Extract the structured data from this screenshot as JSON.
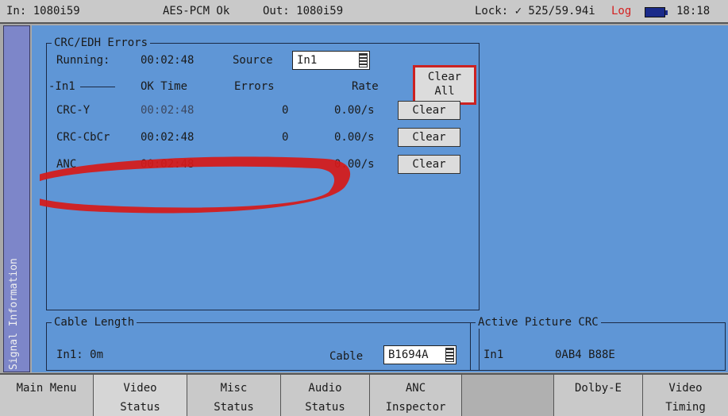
{
  "status": {
    "input": "In: 1080i59",
    "audio": "AES-PCM Ok",
    "output": "Out: 1080i59",
    "lock": "Lock: ✓ 525/59.94i",
    "log": "Log",
    "time": "18:18"
  },
  "sidebar": {
    "label": "Signal Information"
  },
  "crc_edh": {
    "title": "CRC/EDH Errors",
    "running_label": "Running:",
    "running_value": "00:02:48",
    "source_label": "Source",
    "source_value": "In1",
    "clear_all_line1": "Clear",
    "clear_all_line2": "All",
    "table_input": "-In1",
    "col_ok_time": "OK Time",
    "col_errors": "Errors",
    "col_rate": "Rate",
    "rows": [
      {
        "name": "CRC-Y",
        "ok_time": "00:02:48",
        "errors": "0",
        "rate": "0.00/s",
        "clear": "Clear"
      },
      {
        "name": "CRC-CbCr",
        "ok_time": "00:02:48",
        "errors": "0",
        "rate": "0.00/s",
        "clear": "Clear"
      },
      {
        "name": "ANC",
        "ok_time": "00:02:48",
        "errors": "",
        "rate": "0.00/s",
        "clear": "Clear"
      }
    ]
  },
  "cable_length": {
    "title": "Cable Length",
    "reading": "In1: 0m",
    "cable_label": "Cable",
    "cable_value": "B1694A"
  },
  "active_picture_crc": {
    "title": "Active Picture CRC",
    "input": "In1",
    "value": "0AB4 B88E"
  },
  "menu": [
    {
      "line1": "Main Menu",
      "line2": ""
    },
    {
      "line1": "Video",
      "line2": "Status"
    },
    {
      "line1": "Misc",
      "line2": "Status"
    },
    {
      "line1": "Audio",
      "line2": "Status"
    },
    {
      "line1": "ANC",
      "line2": "Inspector"
    },
    {
      "line1": "",
      "line2": ""
    },
    {
      "line1": "Dolby-E",
      "line2": ""
    },
    {
      "line1": "Video",
      "line2": "Timing"
    }
  ],
  "colors": {
    "accent_red": "#cc2222",
    "panel_blue": "#5f96d6",
    "sidebar_purple": "#7d86c9"
  }
}
